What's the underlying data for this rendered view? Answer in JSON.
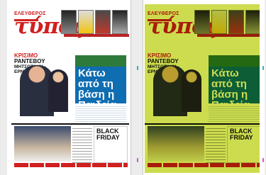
{
  "pages": [
    {
      "tagline": "ΕΛΕΥΘΕΡΟΣ",
      "logo": "τύπος",
      "left_headline_1": "ΚΡΙΣΙΜΟ",
      "left_headline_2": "ΡΑΝΤΕΒΟΥ",
      "left_headline_3": "ΜΗΤΣΟΤΑΚΗ - ΕΡΝΤΟΓΑΝ",
      "main_title": "Κάτω από τη βάση η Παιδεία",
      "black_friday": "BLACK FRIDAY"
    },
    {
      "tagline": "ΕΛΕΥΘΕΡΟΣ",
      "logo": "τύπος",
      "left_headline_1": "ΚΡΙΣΙΜΟ",
      "left_headline_2": "ΡΑΝΤΕΒΟΥ",
      "left_headline_3": "ΜΗΤΣΟΤΑΚΗ - ΕΡΝΤΟΓΑΝ",
      "main_title": "Κάτω από τη βάση η Παιδεία",
      "black_friday": "BLACK FRIDAY"
    }
  ],
  "colors": {
    "brand": "#d12020",
    "overlay_tint": "#c8d83a",
    "panel_blue": "#0f6db1"
  }
}
